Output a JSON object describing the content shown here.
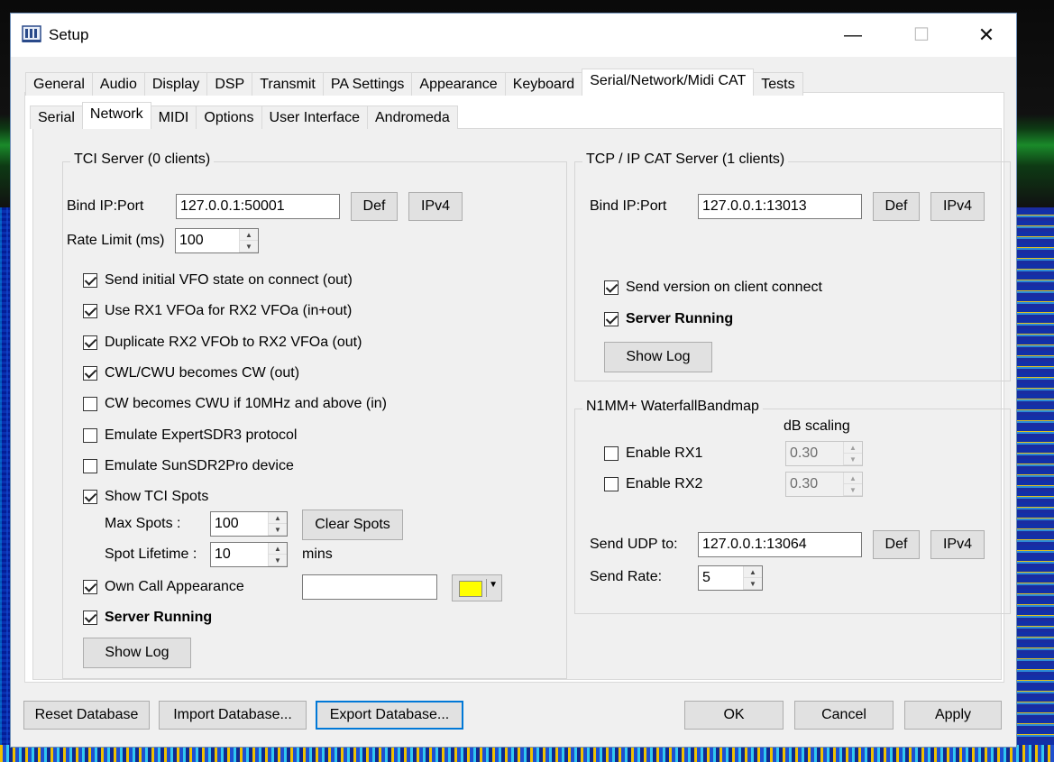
{
  "window": {
    "title": "Setup",
    "minimize": "—",
    "maximize": "☐",
    "close": "✕"
  },
  "tabs_main": [
    "General",
    "Audio",
    "Display",
    "DSP",
    "Transmit",
    "PA Settings",
    "Appearance",
    "Keyboard",
    "Serial/Network/Midi CAT",
    "Tests"
  ],
  "tabs_main_active": "Serial/Network/Midi CAT",
  "tabs_sub": [
    "Serial",
    "Network",
    "MIDI",
    "Options",
    "User Interface",
    "Andromeda"
  ],
  "tabs_sub_active": "Network",
  "tci": {
    "title": "TCI Server (0 clients)",
    "bind_label": "Bind IP:Port",
    "bind_value": "127.0.0.1:50001",
    "def_label": "Def",
    "ipv4_label": "IPv4",
    "rate_label": "Rate Limit (ms)",
    "rate_value": "100",
    "checks": [
      {
        "label": "Send initial VFO state on connect (out)",
        "checked": true
      },
      {
        "label": "Use RX1 VFOa for RX2 VFOa (in+out)",
        "checked": true
      },
      {
        "label": "Duplicate RX2 VFOb to RX2 VFOa (out)",
        "checked": true
      },
      {
        "label": "CWL/CWU becomes CW (out)",
        "checked": true
      },
      {
        "label": "CW becomes CWU if 10MHz and above (in)",
        "checked": false
      },
      {
        "label": "Emulate ExpertSDR3 protocol",
        "checked": false
      },
      {
        "label": "Emulate SunSDR2Pro device",
        "checked": false
      },
      {
        "label": "Show TCI Spots",
        "checked": true
      }
    ],
    "max_spots_label": "Max Spots :",
    "max_spots_value": "100",
    "clear_spots_label": "Clear Spots",
    "spot_lifetime_label": "Spot Lifetime :",
    "spot_lifetime_value": "10",
    "spot_lifetime_unit": "mins",
    "own_call_label": "Own Call Appearance",
    "own_call_checked": true,
    "own_call_value": "",
    "own_call_color": "#ffff00",
    "server_running_label": "Server Running",
    "server_running_checked": true,
    "show_log_label": "Show Log"
  },
  "cat": {
    "title": "TCP / IP CAT Server (1 clients)",
    "bind_label": "Bind IP:Port",
    "bind_value": "127.0.0.1:13013",
    "def_label": "Def",
    "ipv4_label": "IPv4",
    "send_version_label": "Send version on client connect",
    "send_version_checked": true,
    "server_running_label": "Server Running",
    "server_running_checked": true,
    "show_log_label": "Show Log"
  },
  "n1mm": {
    "title": "N1MM+ WaterfallBandmap",
    "db_scaling_label": "dB scaling",
    "rx1_label": "Enable RX1",
    "rx1_checked": false,
    "rx1_db": "0.30",
    "rx2_label": "Enable RX2",
    "rx2_checked": false,
    "rx2_db": "0.30",
    "send_udp_label": "Send UDP to:",
    "send_udp_value": "127.0.0.1:13064",
    "def_label": "Def",
    "ipv4_label": "IPv4",
    "send_rate_label": "Send Rate:",
    "send_rate_value": "5"
  },
  "footer": {
    "reset": "Reset Database",
    "import": "Import Database...",
    "export": "Export Database...",
    "ok": "OK",
    "cancel": "Cancel",
    "apply": "Apply"
  }
}
